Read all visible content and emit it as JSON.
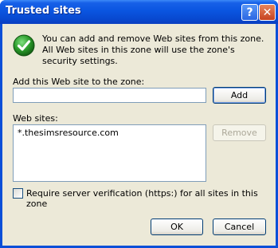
{
  "window": {
    "title": "Trusted sites",
    "help_glyph": "?",
    "close_glyph": "✕"
  },
  "info": {
    "icon": "check-shield-icon",
    "text": "You can add and remove Web sites from this zone. All Web sites in this zone will use the zone's security settings."
  },
  "add_section": {
    "label": "Add this Web site to the zone:",
    "input_value": "",
    "add_button": "Add"
  },
  "websites": {
    "label": "Web sites:",
    "items": [
      "*.thesimsresource.com"
    ],
    "remove_button": "Remove"
  },
  "verification": {
    "label": "Require server verification (https:) for all sites in this zone",
    "checked": false
  },
  "footer": {
    "ok": "OK",
    "cancel": "Cancel"
  },
  "colors": {
    "titlebar": "#0a55e0",
    "dialog_bg": "#ece9d8",
    "accent_green": "#2a8a2a"
  }
}
